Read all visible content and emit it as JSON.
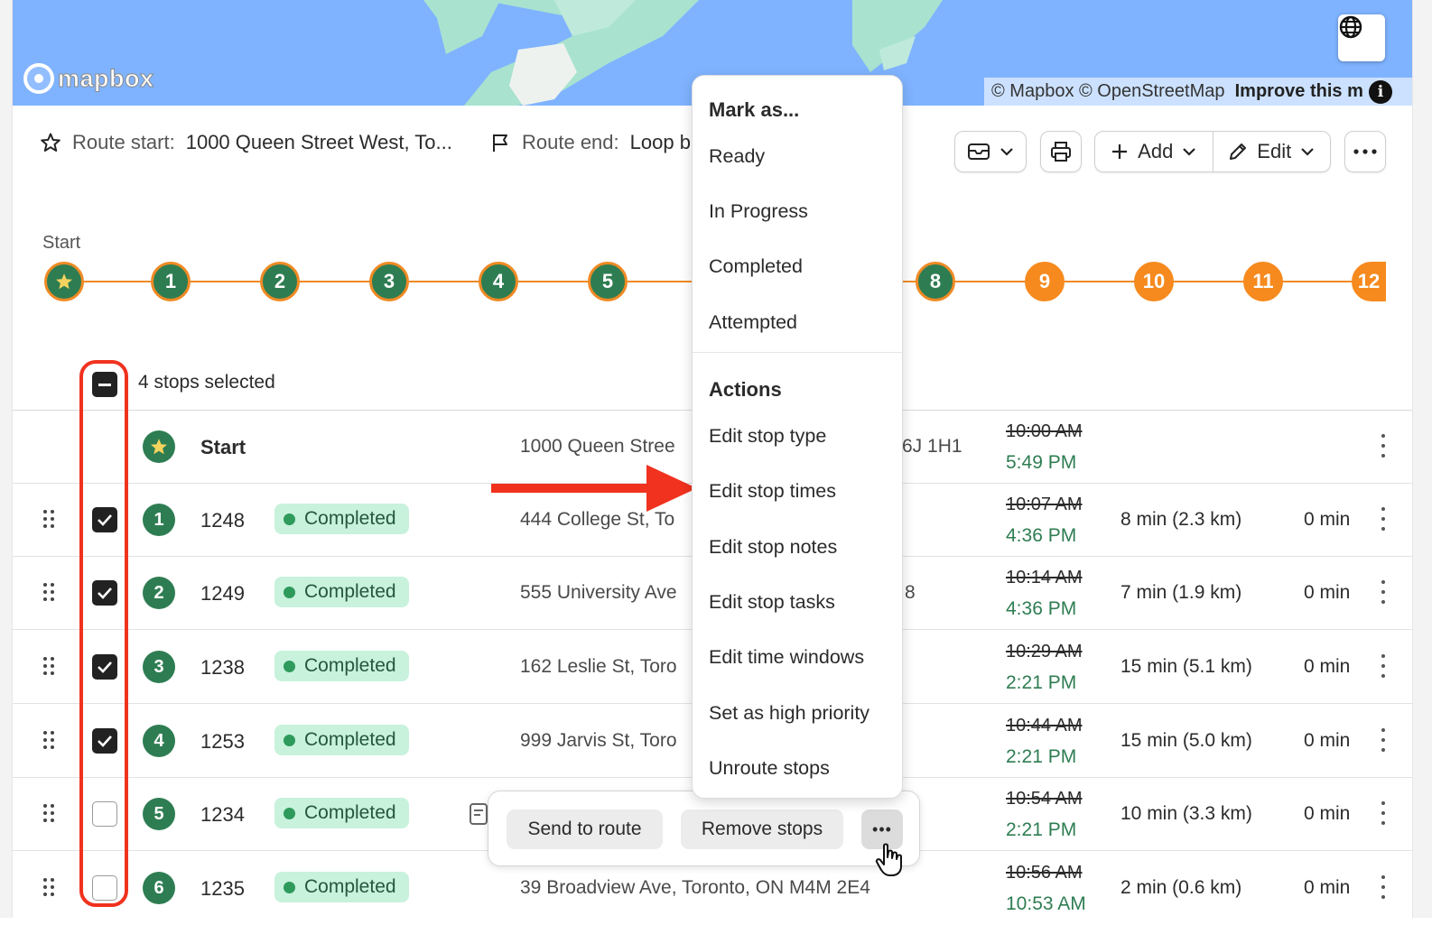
{
  "map": {
    "logo_text": "mapbox",
    "attribution": "© Mapbox © OpenStreetMap",
    "attribution_link": "Improve this m",
    "info_glyph": "i",
    "globe_icon": "globe-icon"
  },
  "route": {
    "start_label": "Route start:",
    "start_value": "1000 Queen Street West, To...",
    "end_label": "Route end:",
    "end_value": "Loop b"
  },
  "toolbar": {
    "add_label": "Add",
    "edit_label": "Edit"
  },
  "stepper": {
    "start_label": "Start",
    "steps": [
      "1",
      "2",
      "3",
      "4",
      "5",
      "8",
      "9",
      "10",
      "11",
      "12"
    ]
  },
  "selection": {
    "text": "4 stops selected"
  },
  "rows": [
    {
      "id": "Start",
      "address": "1000 Queen Stree",
      "postal_tail": "6J 1H1",
      "orig_time": "10:00 AM",
      "new_time": "5:49 PM",
      "travel": "",
      "service": "",
      "checked": false
    },
    {
      "num": "1",
      "id": "1248",
      "status": "Completed",
      "address": "444 College St, To",
      "orig_time": "10:07 AM",
      "new_time": "4:36 PM",
      "travel": "8 min (2.3 km)",
      "service": "0 min",
      "checked": true
    },
    {
      "num": "2",
      "id": "1249",
      "status": "Completed",
      "address": "555 University Ave",
      "postal_tail": "8",
      "orig_time": "10:14 AM",
      "new_time": "4:36 PM",
      "travel": "7 min (1.9 km)",
      "service": "0 min",
      "checked": true
    },
    {
      "num": "3",
      "id": "1238",
      "status": "Completed",
      "address": "162 Leslie St, Toro",
      "orig_time": "10:29 AM",
      "new_time": "2:21 PM",
      "travel": "15 min (5.1 km)",
      "service": "0 min",
      "checked": true
    },
    {
      "num": "4",
      "id": "1253",
      "status": "Completed",
      "address": "999 Jarvis St, Toro",
      "orig_time": "10:44 AM",
      "new_time": "2:21 PM",
      "travel": "15 min (5.0 km)",
      "service": "0 min",
      "checked": true
    },
    {
      "num": "5",
      "id": "1234",
      "status": "Completed",
      "address": "",
      "orig_time": "10:54 AM",
      "new_time": "2:21 PM",
      "travel": "10 min (3.3 km)",
      "service": "0 min",
      "checked": false
    },
    {
      "num": "6",
      "id": "1235",
      "status": "Completed",
      "address": "39 Broadview Ave, Toronto, ON M4M 2E4",
      "orig_time": "10:56 AM",
      "new_time": "10:53 AM",
      "travel": "2 min (0.6 km)",
      "service": "0 min",
      "checked": false
    }
  ],
  "action_bar": {
    "send_label": "Send to route",
    "remove_label": "Remove stops",
    "more_label": "•••"
  },
  "menu": {
    "mark_header": "Mark as...",
    "mark_items": [
      "Ready",
      "In Progress",
      "Completed",
      "Attempted"
    ],
    "actions_header": "Actions",
    "action_items": [
      "Edit stop type",
      "Edit stop times",
      "Edit stop notes",
      "Edit stop tasks",
      "Edit time windows",
      "Set as high priority",
      "Unroute stops"
    ]
  },
  "colors": {
    "accent_green": "#2e7d52",
    "accent_orange": "#f68a1e",
    "badge_bg": "#c8f2dc",
    "annotation_red": "#f0321e",
    "map_water": "#7fb3ff"
  }
}
